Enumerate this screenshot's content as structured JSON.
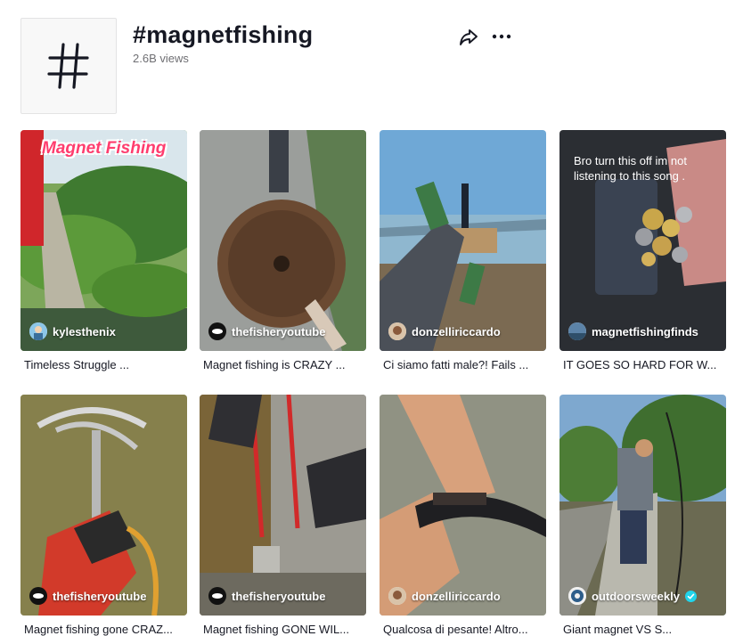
{
  "hashtag": {
    "title": "#magnetfishing",
    "views": "2.6B views",
    "icon": "hashtag-icon"
  },
  "actions": {
    "share_icon": "share-arrow-icon",
    "more_icon": "more-dots-icon"
  },
  "videos": [
    {
      "author": "kylesthenix",
      "verified": false,
      "caption": "Timeless Struggle ...",
      "overlay_text": "Magnet Fishing"
    },
    {
      "author": "thefisheryoutube",
      "verified": false,
      "caption": "Magnet fishing is CRAZY ..."
    },
    {
      "author": "donzelliriccardo",
      "verified": false,
      "caption": "Ci siamo fatti male?! Fails ..."
    },
    {
      "author": "magnetfishingfinds",
      "verified": false,
      "caption": "IT GOES SO HARD FOR W...",
      "overlay_text": "Bro turn this off im not listening to this song ."
    },
    {
      "author": "thefisheryoutube",
      "verified": false,
      "caption": "Magnet fishing gone CRAZ..."
    },
    {
      "author": "thefisheryoutube",
      "verified": false,
      "caption": "Magnet fishing GONE WIL..."
    },
    {
      "author": "donzelliriccardo",
      "verified": false,
      "caption": "Qualcosa di pesante! Altro..."
    },
    {
      "author": "outdoorsweekly",
      "verified": true,
      "caption": "Giant magnet VS S..."
    }
  ],
  "colors": {
    "verified_badge": "#20d5ec",
    "text_primary": "#161823",
    "text_secondary": "#6f6f73"
  }
}
